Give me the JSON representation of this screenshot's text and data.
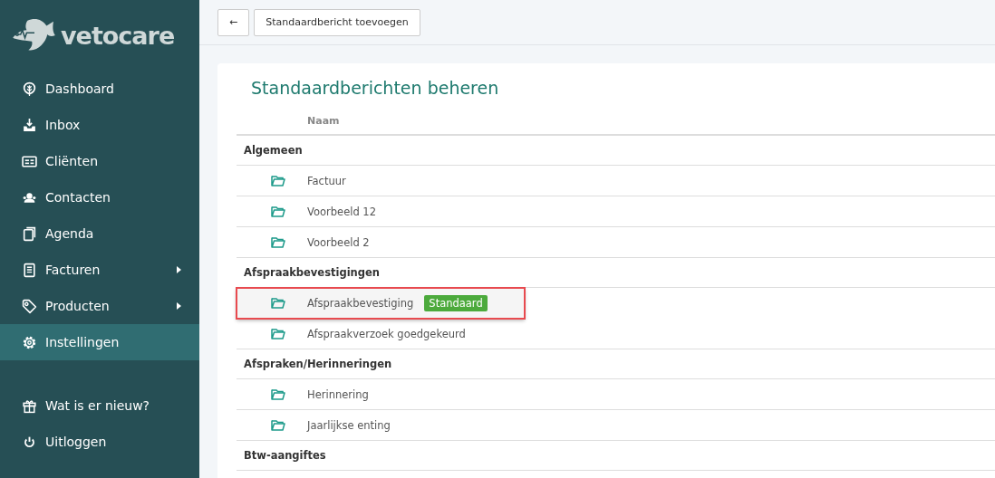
{
  "sidebar": {
    "logo": "vetocare",
    "items": [
      {
        "label": "Dashboard",
        "selected": false,
        "submenu": false
      },
      {
        "label": "Inbox",
        "selected": false,
        "submenu": false
      },
      {
        "label": "Cliënten",
        "selected": false,
        "submenu": false
      },
      {
        "label": "Contacten",
        "selected": false,
        "submenu": false
      },
      {
        "label": "Agenda",
        "selected": false,
        "submenu": false
      },
      {
        "label": "Facturen",
        "selected": false,
        "submenu": true
      },
      {
        "label": "Producten",
        "selected": false,
        "submenu": true
      },
      {
        "label": "Instellingen",
        "selected": true,
        "submenu": false
      }
    ],
    "bottom_items": [
      {
        "label": "Wat is er nieuw?",
        "selected": false
      },
      {
        "label": "Uitloggen",
        "selected": false
      }
    ]
  },
  "toolbar": {
    "back_button": "←",
    "add_button": "Standaardbericht toevoegen"
  },
  "page": {
    "title": "Standaardberichten beheren",
    "table": {
      "columns": [
        "Naam"
      ],
      "groups": [
        {
          "name": "Algemeen",
          "items": [
            {
              "name": "Factuur",
              "highlighted": false
            },
            {
              "name": "Voorbeeld 12",
              "highlighted": false
            },
            {
              "name": "Voorbeeld 2",
              "highlighted": false
            }
          ]
        },
        {
          "name": "Afspraakbevestigingen",
          "items": [
            {
              "name": "Afspraakbevestiging",
              "badge": "Standaard",
              "highlighted": true
            },
            {
              "name": "Afspraakverzoek goedgekeurd",
              "highlighted": false
            }
          ]
        },
        {
          "name": "Afspraken/Herinneringen",
          "items": [
            {
              "name": "Herinnering",
              "highlighted": false
            },
            {
              "name": "Jaarlijkse enting",
              "highlighted": false
            }
          ]
        },
        {
          "name": "Btw-aangiftes"
        }
      ]
    }
  }
}
